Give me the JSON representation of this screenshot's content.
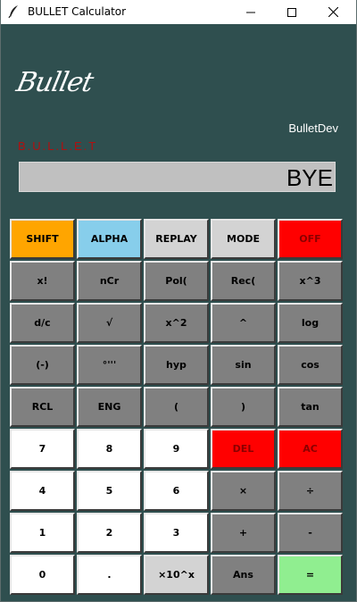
{
  "window": {
    "title": "BULLET Calculator",
    "icon": "feather-icon"
  },
  "header": {
    "logo": "Bullet",
    "dev": "BulletDev",
    "brand": "B.U.L.L.E.T"
  },
  "display": {
    "value": "BYE"
  },
  "colors": {
    "background": "#2f4f4f",
    "key_gray": "#808080",
    "key_white": "#ffffff",
    "key_light": "#d3d3d3",
    "shift": "#ffa500",
    "alpha": "#87ceeb",
    "red": "#ff0000",
    "equals": "#90ee90"
  },
  "keys": [
    [
      "SHIFT",
      "ALPHA",
      "REPLAY",
      "MODE",
      "OFF"
    ],
    [
      "x!",
      "nCr",
      "Pol(",
      "Rec(",
      "x^3"
    ],
    [
      "d/c",
      "√",
      "x^2",
      "^",
      "log"
    ],
    [
      "(-)",
      "°'''",
      "hyp",
      "sin",
      "cos"
    ],
    [
      "RCL",
      "ENG",
      "(",
      ")",
      "tan"
    ],
    [
      "7",
      "8",
      "9",
      "DEL",
      "AC"
    ],
    [
      "4",
      "5",
      "6",
      "×",
      "÷"
    ],
    [
      "1",
      "2",
      "3",
      "+",
      "-"
    ],
    [
      "0",
      ".",
      "×10^x",
      "Ans",
      "="
    ]
  ]
}
